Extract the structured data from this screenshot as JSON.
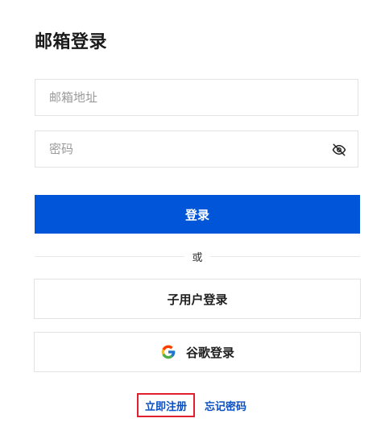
{
  "page": {
    "title": "邮箱登录"
  },
  "email": {
    "placeholder": "邮箱地址",
    "value": ""
  },
  "password": {
    "placeholder": "密码",
    "value": "",
    "toggle_icon": "eye-off-icon"
  },
  "login_button": {
    "label": "登录",
    "color": "#0055d9"
  },
  "divider": {
    "text": "或"
  },
  "subuser_button": {
    "label": "子用户登录"
  },
  "google_button": {
    "label": "谷歌登录",
    "icon": "google-icon"
  },
  "footer": {
    "register_label": "立即注册",
    "forgot_label": "忘记密码",
    "link_color": "#0a4fc4",
    "highlight_color": "#e0202f"
  }
}
